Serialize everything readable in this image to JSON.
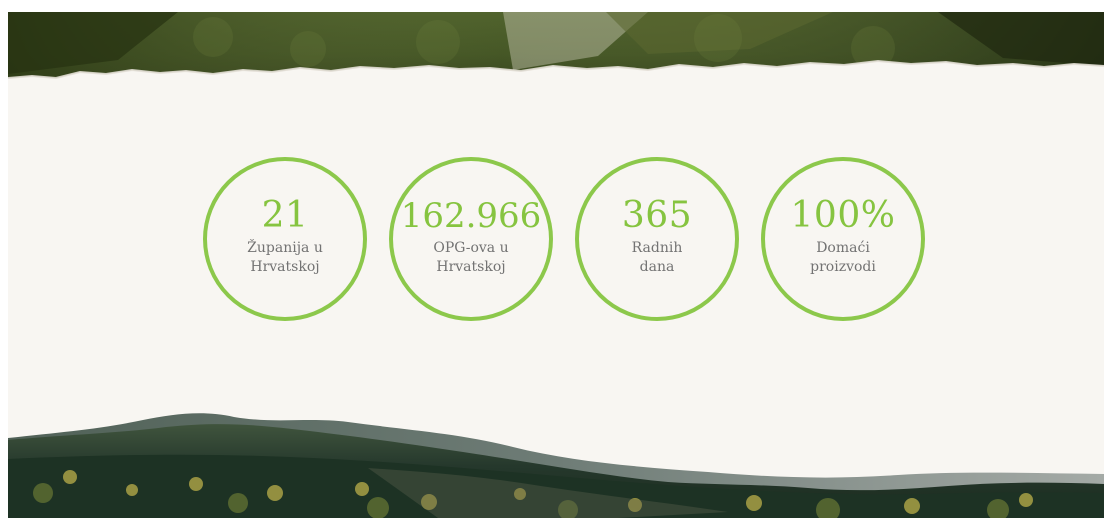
{
  "colors": {
    "accent": "#8cc84b",
    "text": "#737373",
    "panel_background": "#f8f6f2"
  },
  "stats": [
    {
      "value": "21",
      "label_line1": "Županija u",
      "label_line2": "Hrvatskoj"
    },
    {
      "value": "162.966",
      "label_line1": "OPG-ova u",
      "label_line2": "Hrvatskoj"
    },
    {
      "value": "365",
      "label_line1": "Radnih",
      "label_line2": "dana"
    },
    {
      "value": "100%",
      "label_line1": "Domaći",
      "label_line2": "proizvodi"
    }
  ]
}
